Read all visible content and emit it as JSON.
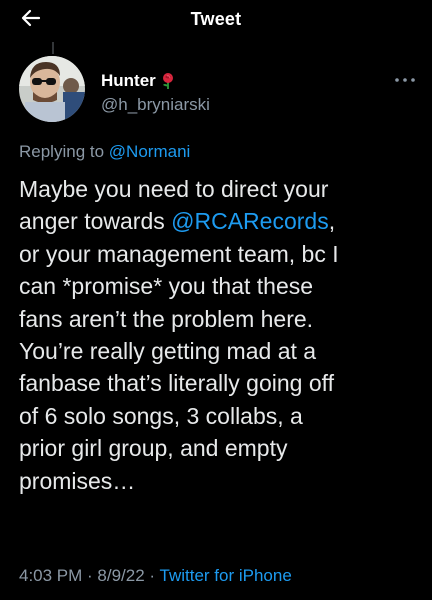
{
  "header": {
    "back_icon": "arrow-left-icon",
    "title": "Tweet"
  },
  "author": {
    "display_name": "Hunter",
    "emoji_icon": "rose-icon",
    "handle": "@h_bryniarski"
  },
  "more_icon": "more-horizontal-icon",
  "reply": {
    "prefix": "Replying to",
    "mention": "@Normani"
  },
  "tweet": {
    "line1": "Maybe you need to direct your",
    "line2_pre": "anger towards ",
    "line2_mention": "@RCARecords",
    "line2_post": ",",
    "line3": "or your management team, bc I",
    "line4": "can *promise* you that these",
    "line5": "fans aren’t the problem here.",
    "line6": "You’re really getting mad at a",
    "line7": "fanbase that’s literally going off",
    "line8": "of 6 solo songs, 3 collabs, a",
    "line9": "prior girl group, and empty",
    "line10": "promises…"
  },
  "meta": {
    "time": "4:03 PM",
    "separator1": " · ",
    "date": "8/9/22",
    "separator2": " · ",
    "source": "Twitter for iPhone"
  },
  "colors": {
    "background": "#000000",
    "text": "#e7e9ea",
    "secondary": "#8b98a5",
    "link": "#1d9bf0"
  }
}
